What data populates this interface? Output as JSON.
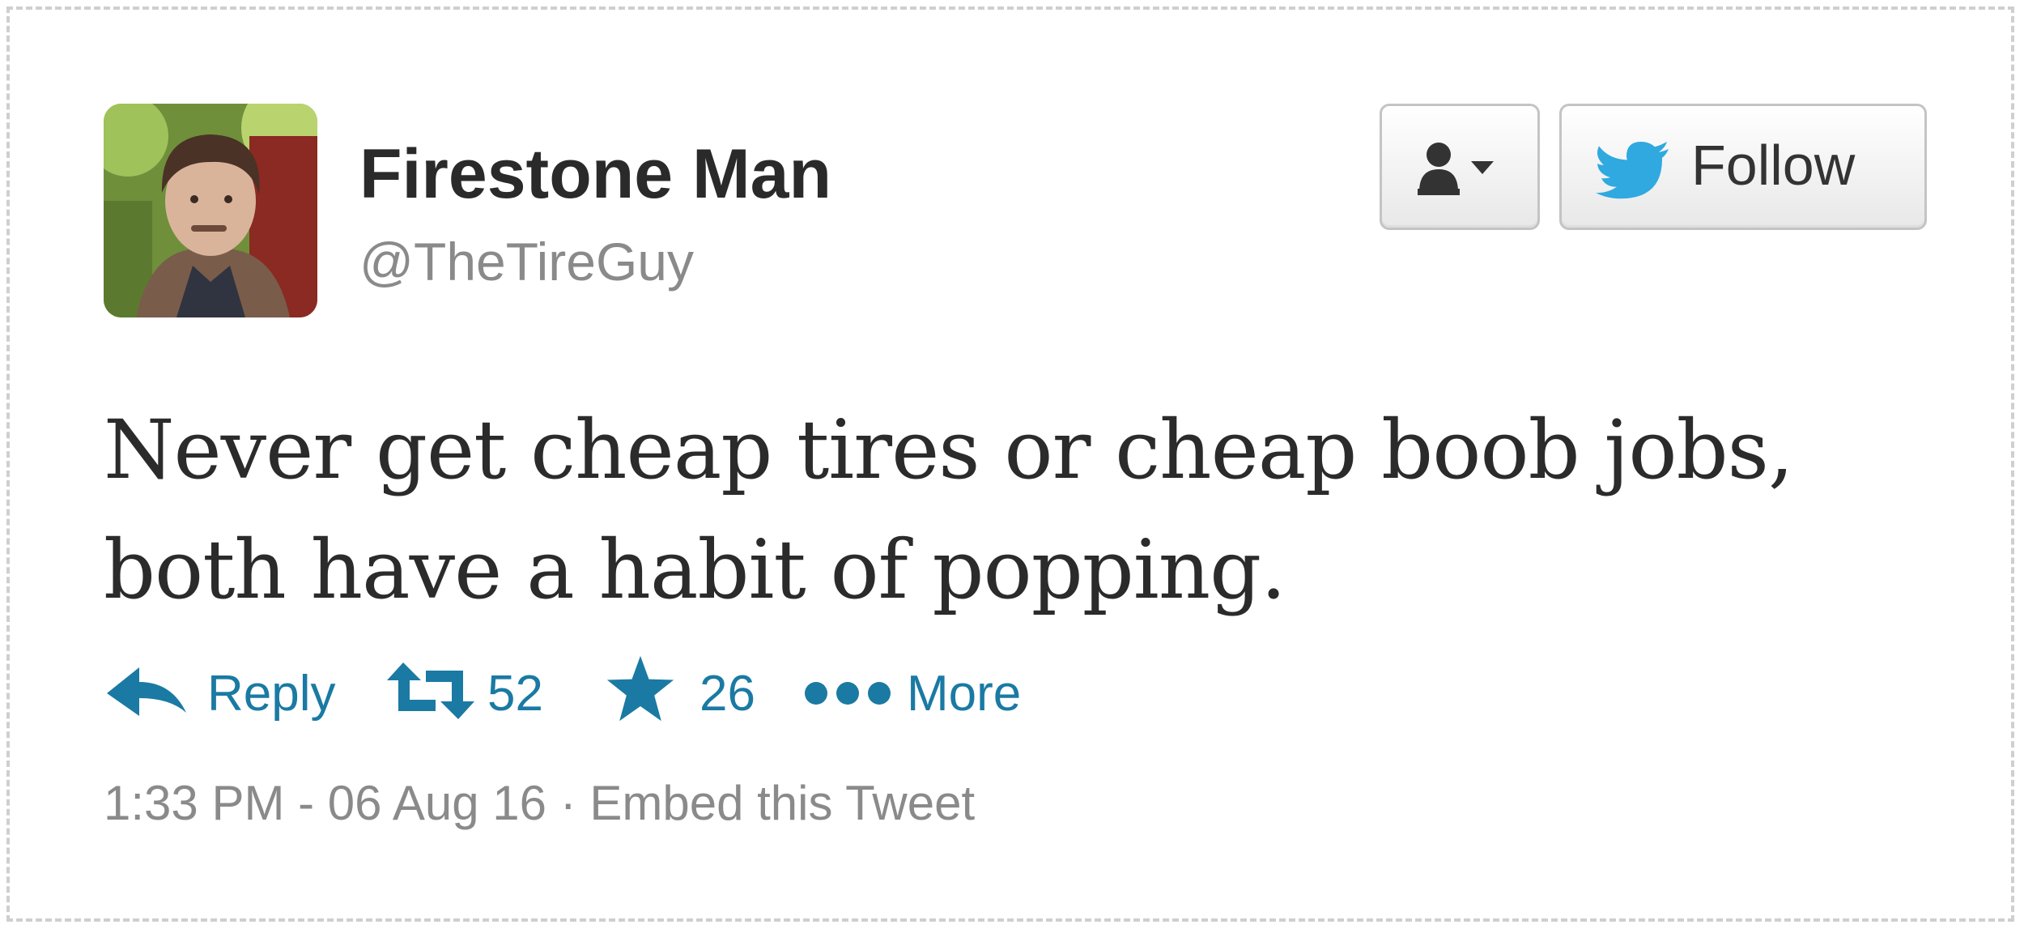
{
  "author": {
    "display_name": "Firestone Man",
    "handle": "@TheTireGuy"
  },
  "buttons": {
    "user_menu_icon": "user-dropdown-icon",
    "follow_label": "Follow",
    "follow_icon": "twitter-bird-icon"
  },
  "tweet": {
    "text": "Never get cheap tires or cheap boob jobs, both have a habit of popping."
  },
  "actions": {
    "reply_label": "Reply",
    "retweet_count": "52",
    "favorite_count": "26",
    "more_label": "More"
  },
  "footer": {
    "timestamp": "1:33 PM - 06 Aug 16",
    "separator": "·",
    "embed_label": "Embed this Tweet"
  },
  "colors": {
    "action_blue": "#1a7aa3",
    "twitter_blue": "#2fa9e0",
    "name_text": "#2a2a2a",
    "muted_text": "#8a8a8a"
  }
}
